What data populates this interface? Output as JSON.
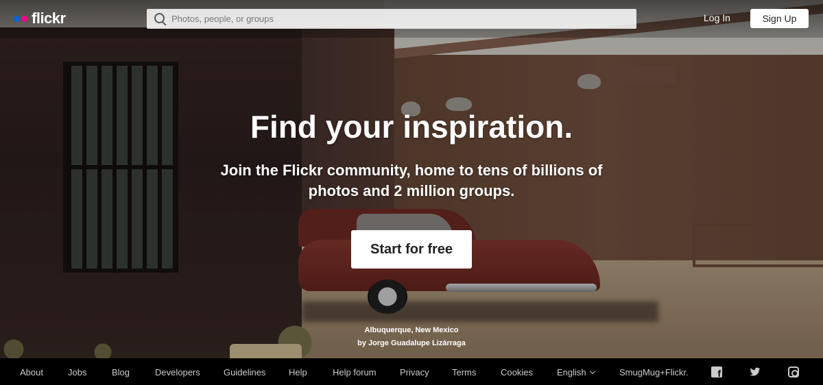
{
  "header": {
    "logo_text": "flickr",
    "logo_colors": {
      "blue": "#0063dc",
      "pink": "#ff0084"
    },
    "search_placeholder": "Photos, people, or groups",
    "login_label": "Log In",
    "signup_label": "Sign Up"
  },
  "hero": {
    "headline": "Find your inspiration.",
    "subline": "Join the Flickr community, home to tens of billions of photos and 2 million groups.",
    "cta_label": "Start for free",
    "credit_location": "Albuquerque, New Mexico",
    "credit_author": "by Jorge Guadalupe Lizárraga"
  },
  "footer": {
    "links": [
      "About",
      "Jobs",
      "Blog",
      "Developers",
      "Guidelines",
      "Help",
      "Help forum",
      "Privacy",
      "Terms",
      "Cookies"
    ],
    "language": "English",
    "smugmug": "SmugMug+Flickr.",
    "social_icons": [
      "facebook-icon",
      "twitter-icon",
      "instagram-icon"
    ]
  }
}
